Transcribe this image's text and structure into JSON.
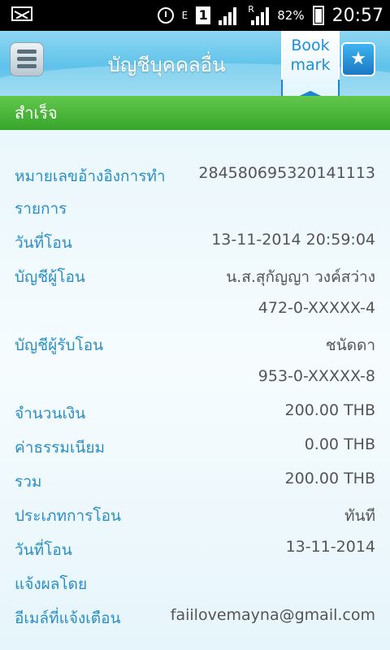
{
  "status_bar": {
    "battery_pct": "82%",
    "time": "20:57",
    "net": "E",
    "sim": "1",
    "roaming": "R"
  },
  "header": {
    "title": "บัญชีบุคคลอื่น",
    "bookmark_line1": "Book",
    "bookmark_line2": "mark"
  },
  "status": {
    "text": "สำเร็จ"
  },
  "details": {
    "ref_label_1": "หมายเลขอ้างอิงการทำ",
    "ref_label_2": "รายการ",
    "ref_value": "284580695320141113",
    "date_label": "วันที่โอน",
    "date_value": "13-11-2014 20:59:04",
    "from_label": "บัญชีผู้โอน",
    "from_name": "น.ส.สุกัญญา วงค์สว่าง",
    "from_account": "472-0-XXXXX-4",
    "to_label": "บัญชีผู้รับโอน",
    "to_name": "ชนัดดา",
    "to_account": "953-0-XXXXX-8",
    "amount_label": "จำนวนเงิน",
    "amount_value": "200.00 THB",
    "fee_label": "ค่าธรรมเนียม",
    "fee_value": "0.00 THB",
    "total_label": "รวม",
    "total_value": "200.00 THB",
    "type_label": "ประเภทการโอน",
    "type_value": "ทันที",
    "transfer_date_label": "วันที่โอน",
    "transfer_date_value": "13-11-2014",
    "notify_label": "แจ้งผลโดย",
    "email_label": "อีเมล์ที่แจ้งเตือน",
    "email_value": "faiilovemayna@gmail.com"
  }
}
